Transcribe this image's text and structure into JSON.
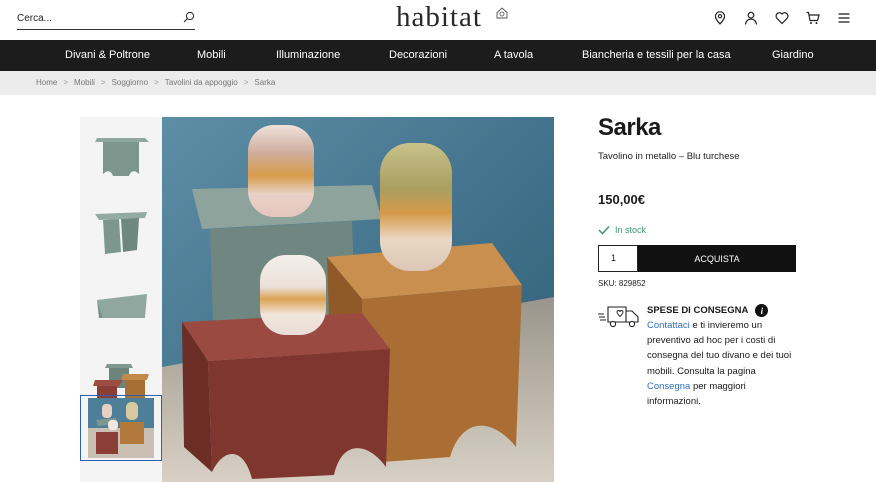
{
  "search": {
    "placeholder": "Cerca..."
  },
  "brand": {
    "logo": "habitat"
  },
  "header_icons": [
    "location-pin-icon",
    "user-icon",
    "heart-icon",
    "cart-icon",
    "menu-icon"
  ],
  "nav": {
    "items": [
      "Divani & Poltrone",
      "Mobili",
      "Illuminazione",
      "Decorazioni",
      "A tavola",
      "Biancheria e tessili per la casa",
      "Giardino"
    ]
  },
  "breadcrumb": [
    "Home",
    "Mobili",
    "Soggiorno",
    "Tavolini da appoggio",
    "Sarka"
  ],
  "breadcrumb_separator": ">",
  "product": {
    "name": "Sarka",
    "subtitle": "Tavolino in metallo – Blu turchese",
    "price": "150,00€",
    "stock": "In stock",
    "quantity": "1",
    "buy_label": "ACQUISTA",
    "sku": "SKU: 829852"
  },
  "shipping": {
    "heading": "SPESE DI CONSEGNA",
    "info_glyph": "i",
    "link1": "Contattaci",
    "text1": " e ti invieremo un preventivo ad hoc per i costi di consegna del tuo divano e dei tuoi mobili. Consulta la pagina ",
    "link2": "Consegna",
    "text2": " per maggiori informazioni."
  },
  "colors": {
    "nav_bg": "#1c1c1c",
    "accent_link": "#2f6fc0",
    "stock_green": "#3a9a6e",
    "buy_button": "#111111",
    "active_thumb_border": "#2f5fb3"
  }
}
